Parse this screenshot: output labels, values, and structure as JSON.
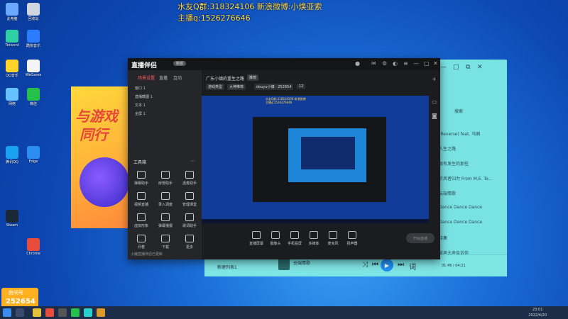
{
  "overlay": {
    "line1": "水友Q群:318324106 新浪微博:小焕亚索",
    "line2": "主播q:1526276646"
  },
  "desktop_icons": [
    {
      "label": "此电脑",
      "color": "#6aa9ff"
    },
    {
      "label": "回收站",
      "color": "#cfd6df"
    },
    {
      "label": "Tencent",
      "color": "#2fd0a5"
    },
    {
      "label": "酷狗音乐",
      "color": "#2b7cff"
    },
    {
      "label": "QQ音乐",
      "color": "#ffd32a"
    },
    {
      "label": "WeGame",
      "color": "#f4f4f4"
    },
    {
      "label": "网络",
      "color": "#67c3ff"
    },
    {
      "label": "微信",
      "color": "#27c04a"
    },
    {
      "label": "腾讯QQ",
      "color": "#1ba1f2"
    },
    {
      "label": "Edge",
      "color": "#2c8ef2"
    },
    {
      "label": "Steam",
      "color": "#1b2838"
    },
    {
      "label": "Chrome",
      "color": "#e74c3c"
    }
  ],
  "promo": {
    "line1": "与游戏",
    "line2": "同行"
  },
  "app": {
    "logo": "直播伴侣",
    "version": "新版",
    "tabs": [
      "场景设置",
      "直播",
      "互动"
    ],
    "sources": [
      "窗口 1",
      "直播截图 1",
      "文本 1",
      "全屏 1"
    ],
    "tools_title": "工具箱",
    "tools": [
      "弹幕助手",
      "房管助手",
      "连麦助手",
      "视频直播",
      "录入调度",
      "管理课堂",
      "虚拟形象",
      "弹幕播报",
      "歌词助手",
      "问卷",
      "下载",
      "更多"
    ],
    "footer": "小鹿直播伴侣已更新",
    "scene_name": "广东小镇的重生之路",
    "scene_tag": "推荐",
    "pills": [
      "游戏类型",
      "大神推荐",
      "douyu小镇 · 252654",
      "12"
    ],
    "bottom_buttons": [
      "直播屏幕",
      "摄像头",
      "手机投屏",
      "多媒体",
      "麦克风",
      "扬声器"
    ],
    "go_live": "开始直播"
  },
  "preview": {
    "cap1": "水友Q群:318324106 新浪微博",
    "cap2": "主播q:1526276646"
  },
  "music": {
    "search": "搜索",
    "rows": [
      "(Reverse) feat. 乌鸦",
      "人生之路",
      "很有发生的那些",
      "听风者归为 From M.E. To...",
      "云端情歌",
      "Dance Dance Dance",
      "Dance Dance Dance",
      "诗集",
      "放声大声告诉你"
    ],
    "now_playing": "新建列表1",
    "song": "云端情歌",
    "time": "01:46 / 04:21"
  },
  "badge": {
    "label": "房间号",
    "room": "252654"
  },
  "taskbar": {
    "time": "23:01",
    "date": "2022/4/20"
  }
}
